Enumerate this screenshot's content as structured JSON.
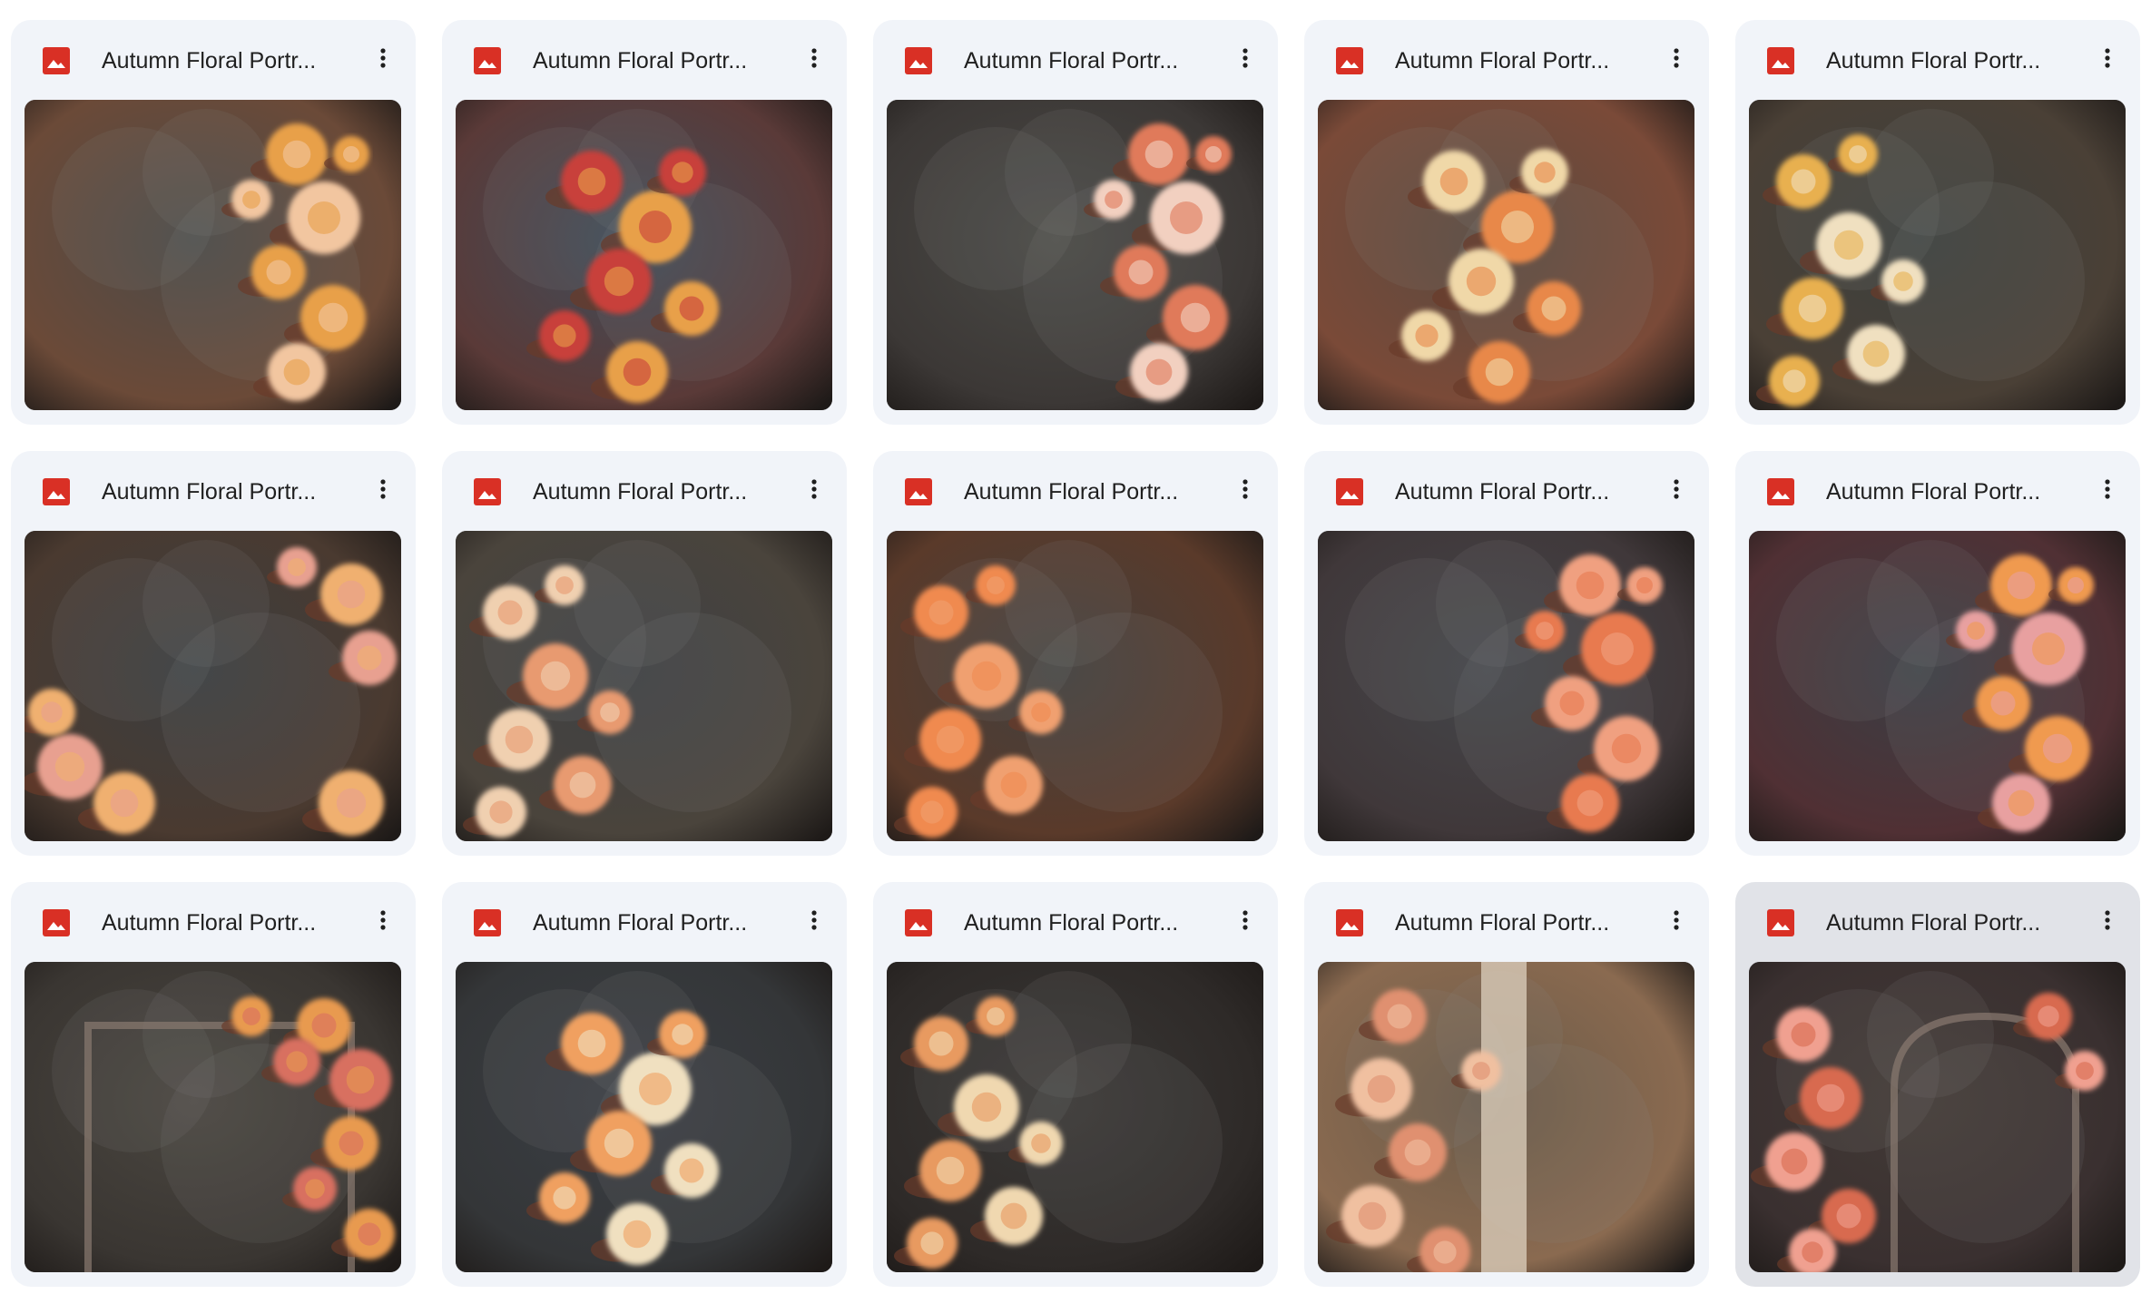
{
  "colors": {
    "card_bg": "#f1f4f9",
    "card_selected_bg": "#e1e3e8",
    "file_icon_red": "#d93025",
    "text": "#1f1f1f"
  },
  "files": [
    {
      "name": "Autumn Floral Portr...",
      "icon": "image-file-icon",
      "menu_icon": "more-vert-icon",
      "palette": [
        "#4b4a48",
        "#6b4a38",
        "#e8a04a",
        "#f2c6a0"
      ],
      "flowers": "right",
      "selected": false
    },
    {
      "name": "Autumn Floral Portr...",
      "icon": "image-file-icon",
      "menu_icon": "more-vert-icon",
      "palette": [
        "#3f4d5a",
        "#5a3a38",
        "#c8403a",
        "#e8a04a"
      ],
      "flowers": "center",
      "selected": false
    },
    {
      "name": "Autumn Floral Portr...",
      "icon": "image-file-icon",
      "menu_icon": "more-vert-icon",
      "palette": [
        "#4a4a46",
        "#3c3836",
        "#e07a5a",
        "#f2d0c0"
      ],
      "flowers": "right",
      "selected": false
    },
    {
      "name": "Autumn Floral Portr...",
      "icon": "image-file-icon",
      "menu_icon": "more-vert-icon",
      "palette": [
        "#5a4a40",
        "#7a4a38",
        "#f0d8a8",
        "#e8884a"
      ],
      "flowers": "center",
      "selected": false
    },
    {
      "name": "Autumn Floral Portr...",
      "icon": "image-file-icon",
      "menu_icon": "more-vert-icon",
      "palette": [
        "#3c403e",
        "#4a4036",
        "#e8b050",
        "#f0e0c0"
      ],
      "flowers": "left",
      "selected": false
    },
    {
      "name": "Autumn Floral Portr...",
      "icon": "image-file-icon",
      "menu_icon": "more-vert-icon",
      "palette": [
        "#3a3e40",
        "#4a3a30",
        "#f0b070",
        "#e8a090"
      ],
      "flowers": "corners",
      "selected": false
    },
    {
      "name": "Autumn Floral Portr...",
      "icon": "image-file-icon",
      "menu_icon": "more-vert-icon",
      "palette": [
        "#3e4044",
        "#4a443c",
        "#f0d0b0",
        "#e89a70"
      ],
      "flowers": "left",
      "selected": false
    },
    {
      "name": "Autumn Floral Portr...",
      "icon": "image-file-icon",
      "menu_icon": "more-vert-icon",
      "palette": [
        "#42403e",
        "#5a3a2a",
        "#f08a50",
        "#f0a070"
      ],
      "flowers": "left",
      "selected": false
    },
    {
      "name": "Autumn Floral Portr...",
      "icon": "image-file-icon",
      "menu_icon": "more-vert-icon",
      "palette": [
        "#44464a",
        "#40383a",
        "#f0a080",
        "#e87a50"
      ],
      "flowers": "right",
      "selected": false
    },
    {
      "name": "Autumn Floral Portr...",
      "icon": "image-file-icon",
      "menu_icon": "more-vert-icon",
      "palette": [
        "#3a3e44",
        "#503034",
        "#f09a50",
        "#e8a0a0"
      ],
      "flowers": "right",
      "selected": false
    },
    {
      "name": "Autumn Floral Portr...",
      "icon": "image-file-icon",
      "menu_icon": "more-vert-icon",
      "palette": [
        "#4a4640",
        "#3a3632",
        "#e89a50",
        "#d87060"
      ],
      "flowers": "arch-right",
      "selected": false
    },
    {
      "name": "Autumn Floral Portr...",
      "icon": "image-file-icon",
      "menu_icon": "more-vert-icon",
      "palette": [
        "#3a3e44",
        "#343638",
        "#f0a060",
        "#f0e0c0"
      ],
      "flowers": "center",
      "selected": false
    },
    {
      "name": "Autumn Floral Portr...",
      "icon": "image-file-icon",
      "menu_icon": "more-vert-icon",
      "palette": [
        "#3a3836",
        "#2e2a28",
        "#e89a60",
        "#f0d8b0"
      ],
      "flowers": "left",
      "selected": false
    },
    {
      "name": "Autumn Floral Portr...",
      "icon": "image-file-icon",
      "menu_icon": "more-vert-icon",
      "palette": [
        "#6a5a48",
        "#8a6a50",
        "#f0c0a0",
        "#e09070"
      ],
      "flowers": "column",
      "selected": false
    },
    {
      "name": "Autumn Floral Portr...",
      "icon": "image-file-icon",
      "menu_icon": "more-vert-icon",
      "palette": [
        "#423a36",
        "#3a3030",
        "#f0a090",
        "#d86a50"
      ],
      "flowers": "arch-left",
      "selected": true
    }
  ]
}
